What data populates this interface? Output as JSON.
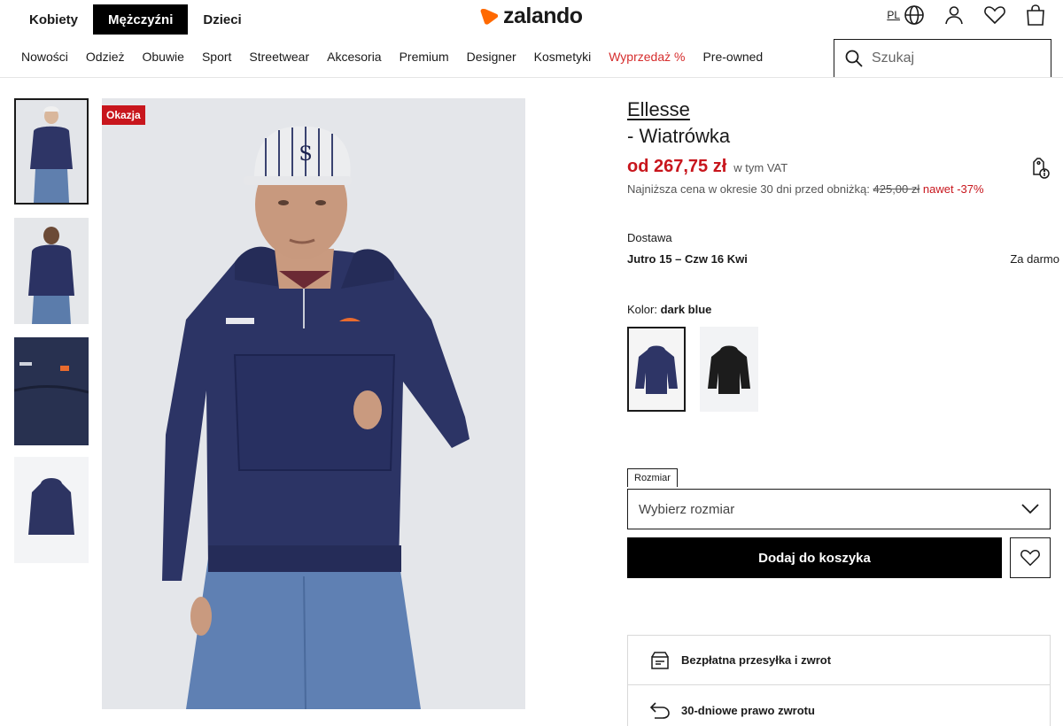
{
  "header": {
    "genders": [
      "Kobiety",
      "Mężczyźni",
      "Dzieci"
    ],
    "active_gender": "Mężczyźni",
    "logo_text": "zalando",
    "lang": "PL",
    "brand_color": "#ff6900"
  },
  "nav": {
    "categories": [
      "Nowości",
      "Odzież",
      "Obuwie",
      "Sport",
      "Streetwear",
      "Akcesoria",
      "Premium",
      "Designer",
      "Kosmetyki",
      "Wyprzedaż %",
      "Pre-owned"
    ],
    "search_placeholder": "Szukaj"
  },
  "gallery": {
    "badge": "Okazja"
  },
  "product": {
    "brand": "Ellesse",
    "name": "- Wiatrówka",
    "price": "od 267,75 zł",
    "vat": "w tym VAT",
    "lowest_prefix": "Najniższa cena w okresie 30 dni przed obniżką:",
    "old_price": "425,00 zł",
    "discount": "nawet -37%",
    "price_color": "#c8161d"
  },
  "delivery": {
    "label": "Dostawa",
    "date": "Jutro 15 – Czw 16 Kwi",
    "cost": "Za darmo"
  },
  "color": {
    "label": "Kolor:",
    "value": "dark blue"
  },
  "size": {
    "tag": "Rozmiar",
    "placeholder": "Wybierz rozmiar"
  },
  "actions": {
    "add_to_cart": "Dodaj do koszyka"
  },
  "benefits": [
    "Bezpłatna przesyłka i zwrot",
    "30-dniowe prawo zwrotu"
  ]
}
